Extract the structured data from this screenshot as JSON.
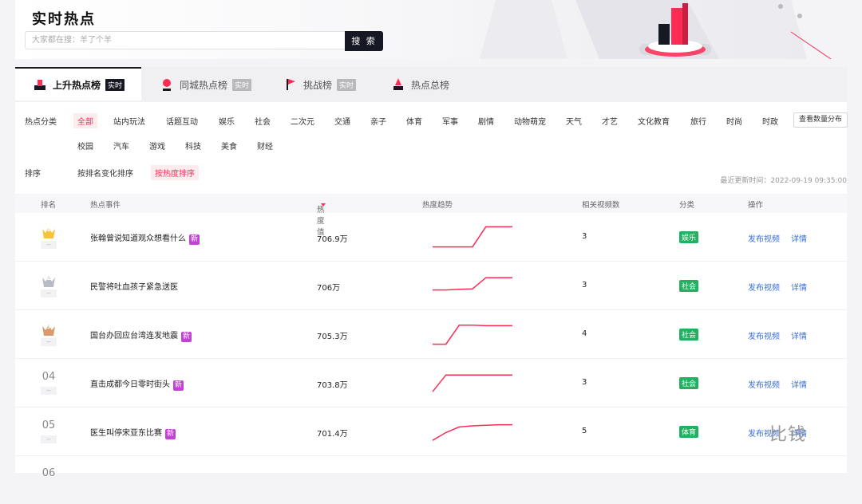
{
  "header": {
    "title": "实时热点",
    "search_placeholder": "大家都在搜：羊了个羊",
    "search_button": "搜 索"
  },
  "tabs": [
    {
      "label": "上升热点榜",
      "tag": "实时"
    },
    {
      "label": "同城热点榜",
      "tag": "实时"
    },
    {
      "label": "挑战榜",
      "tag": "实时"
    },
    {
      "label": "热点总榜",
      "tag": ""
    }
  ],
  "filters": {
    "category_label": "热点分类",
    "categories": [
      "全部",
      "站内玩法",
      "话题互动",
      "娱乐",
      "社会",
      "二次元",
      "交通",
      "亲子",
      "体育",
      "军事",
      "剧情",
      "动物萌宠",
      "天气",
      "才艺",
      "文化教育",
      "旅行",
      "时尚",
      "时政"
    ],
    "categories_row2": [
      "校园",
      "汽车",
      "游戏",
      "科技",
      "美食",
      "财经"
    ],
    "count_button": "查看数量分布",
    "sort_label": "排序",
    "sort_options": [
      "按排名变化排序",
      "按热度排序"
    ],
    "last_update": "最近更新时间：2022-09-19 09:35:00"
  },
  "table": {
    "headers": [
      "排名",
      "热点事件",
      "热度值",
      "热度趋势",
      "相关视频数",
      "分类",
      "操作"
    ],
    "rows": [
      {
        "rank": "1",
        "rank_change": "--",
        "event": "张翰曾说知道观众想看什么",
        "is_new": true,
        "heat": "706.9万",
        "videos": "3",
        "category": "娱乐",
        "trend": [
          0.05,
          0.05,
          0.05,
          0.05,
          0.95,
          0.95,
          0.95
        ]
      },
      {
        "rank": "2",
        "rank_change": "--",
        "event": "民警将吐血孩子紧急送医",
        "is_new": false,
        "heat": "706万",
        "videos": "3",
        "category": "社会",
        "trend": [
          0.3,
          0.3,
          0.33,
          0.35,
          0.85,
          0.85,
          0.85
        ]
      },
      {
        "rank": "3",
        "rank_change": "--",
        "event": "国台办回应台湾连发地震",
        "is_new": true,
        "heat": "705.3万",
        "videos": "4",
        "category": "社会",
        "trend": [
          0.05,
          0.05,
          0.9,
          0.9,
          0.88,
          0.88,
          0.88
        ]
      },
      {
        "rank": "04",
        "rank_change": "--",
        "event": "直击成都今日零时街头",
        "is_new": true,
        "heat": "703.8万",
        "videos": "3",
        "category": "社会",
        "trend": [
          0.1,
          0.85,
          0.85,
          0.85,
          0.85,
          0.85,
          0.85
        ]
      },
      {
        "rank": "05",
        "rank_change": "--",
        "event": "医生叫停宋亚东比赛",
        "is_new": true,
        "heat": "701.4万",
        "videos": "5",
        "category": "体育",
        "trend": [
          0.1,
          0.45,
          0.7,
          0.75,
          0.78,
          0.8,
          0.8
        ]
      }
    ],
    "new_tag": "新",
    "action_publish": "发布视频",
    "action_detail": "详情",
    "partial_rank": "06"
  },
  "watermark": "比钱",
  "colors": {
    "accent": "#fe2c55",
    "dark": "#161823",
    "link": "#3a6fd8",
    "badge_green": "#22b061",
    "new_purple": "#c342d6"
  }
}
